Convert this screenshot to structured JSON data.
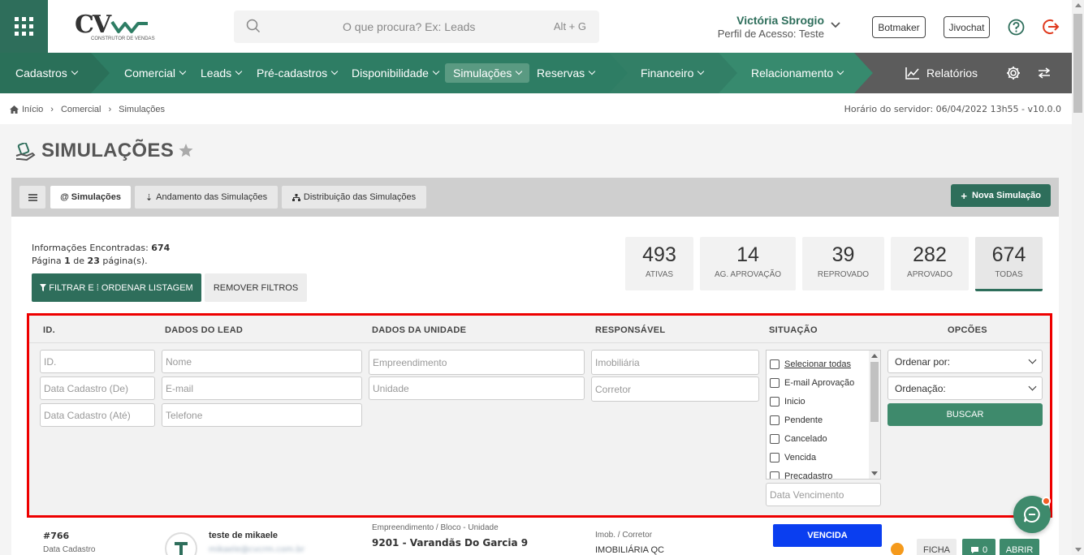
{
  "header": {
    "logo_text": "CV",
    "logo_sub": "CONSTRUTOR DE VENDAS",
    "search_placeholder": "O que procura? Ex: Leads",
    "search_shortcut": "Alt + G",
    "user_name": "Victória Sbrogio",
    "user_profile": "Perfil de Acesso: Teste",
    "botmaker": "Botmaker",
    "jivochat": "Jivochat"
  },
  "nav": {
    "items": [
      {
        "label": "Cadastros"
      },
      {
        "label": "Comercial"
      },
      {
        "label": "Leads"
      },
      {
        "label": "Pré-cadastros"
      },
      {
        "label": "Disponibilidade"
      },
      {
        "label": "Simulações"
      },
      {
        "label": "Reservas"
      },
      {
        "label": "Financeiro"
      },
      {
        "label": "Relacionamento"
      }
    ],
    "reports": "Relatórios"
  },
  "breadcrumb": {
    "items": [
      "Início",
      "Comercial",
      "Simulações"
    ],
    "server_time": "Horário do servidor: 06/04/2022 13h55 - v10.0.0"
  },
  "page": {
    "title": "SIMULAÇÕES",
    "tabs": [
      "Simulações",
      "Andamento das Simulações",
      "Distribuição das Simulações"
    ],
    "new_button": "Nova Simulação",
    "info_found_label": "Informações Encontradas:",
    "info_found_value": "674",
    "info_page_prefix": "Página",
    "info_page_current": "1",
    "info_page_of": "de",
    "info_page_total": "23",
    "info_page_suffix": "página(s).",
    "filter_button": "FILTRAR E ⁞ ORDENAR LISTAGEM",
    "remove_filters": "REMOVER FILTROS"
  },
  "stats": [
    {
      "value": "493",
      "label": "ATIVAS"
    },
    {
      "value": "14",
      "label": "AG. APROVAÇÃO"
    },
    {
      "value": "39",
      "label": "REPROVADO"
    },
    {
      "value": "282",
      "label": "APROVADO"
    },
    {
      "value": "674",
      "label": "TODAS"
    }
  ],
  "filters": {
    "headers": {
      "id": "ID.",
      "lead": "DADOS DO LEAD",
      "unit": "DADOS DA UNIDADE",
      "resp": "RESPONSÁVEL",
      "status": "SITUAÇÃO",
      "options": "OPCÕES"
    },
    "id_ph": "ID.",
    "date_from_ph": "Data Cadastro (De)",
    "date_to_ph": "Data Cadastro (Até)",
    "name_ph": "Nome",
    "email_ph": "E-mail",
    "phone_ph": "Telefone",
    "enterprise_ph": "Empreendimento",
    "unit_ph": "Unidade",
    "agency_ph": "Imobiliária",
    "broker_ph": "Corretor",
    "status_options": [
      "Selecionar todas",
      "E-mail Aprovação",
      "Inicio",
      "Pendente",
      "Cancelado",
      "Vencida",
      "Precadastro"
    ],
    "due_date_ph": "Data Vencimento",
    "order_by": "Ordenar por:",
    "ordering": "Ordenação:",
    "search_button": "BUSCAR"
  },
  "row": {
    "id": "#766",
    "date_label": "Data Cadastro",
    "lead_name": "teste de mikaele",
    "lead_email": "mikaele@cvcrm.com.br",
    "unit_label": "Empreendimento / Bloco - Unidade",
    "unit_value": "9201 - Varandãs Do Garcia 9",
    "resp_label": "Imob. / Corretor",
    "resp_value": "IMOBILIÁRIA QC",
    "status": "VENCIDA",
    "ficha": "FICHA",
    "comments": "0",
    "open": "ABRIR"
  },
  "colors": {
    "brand": "#2e6e5b",
    "nav": "#2e7d64",
    "status_expired": "#0a3ef0",
    "highlight_border": "#e00000"
  }
}
